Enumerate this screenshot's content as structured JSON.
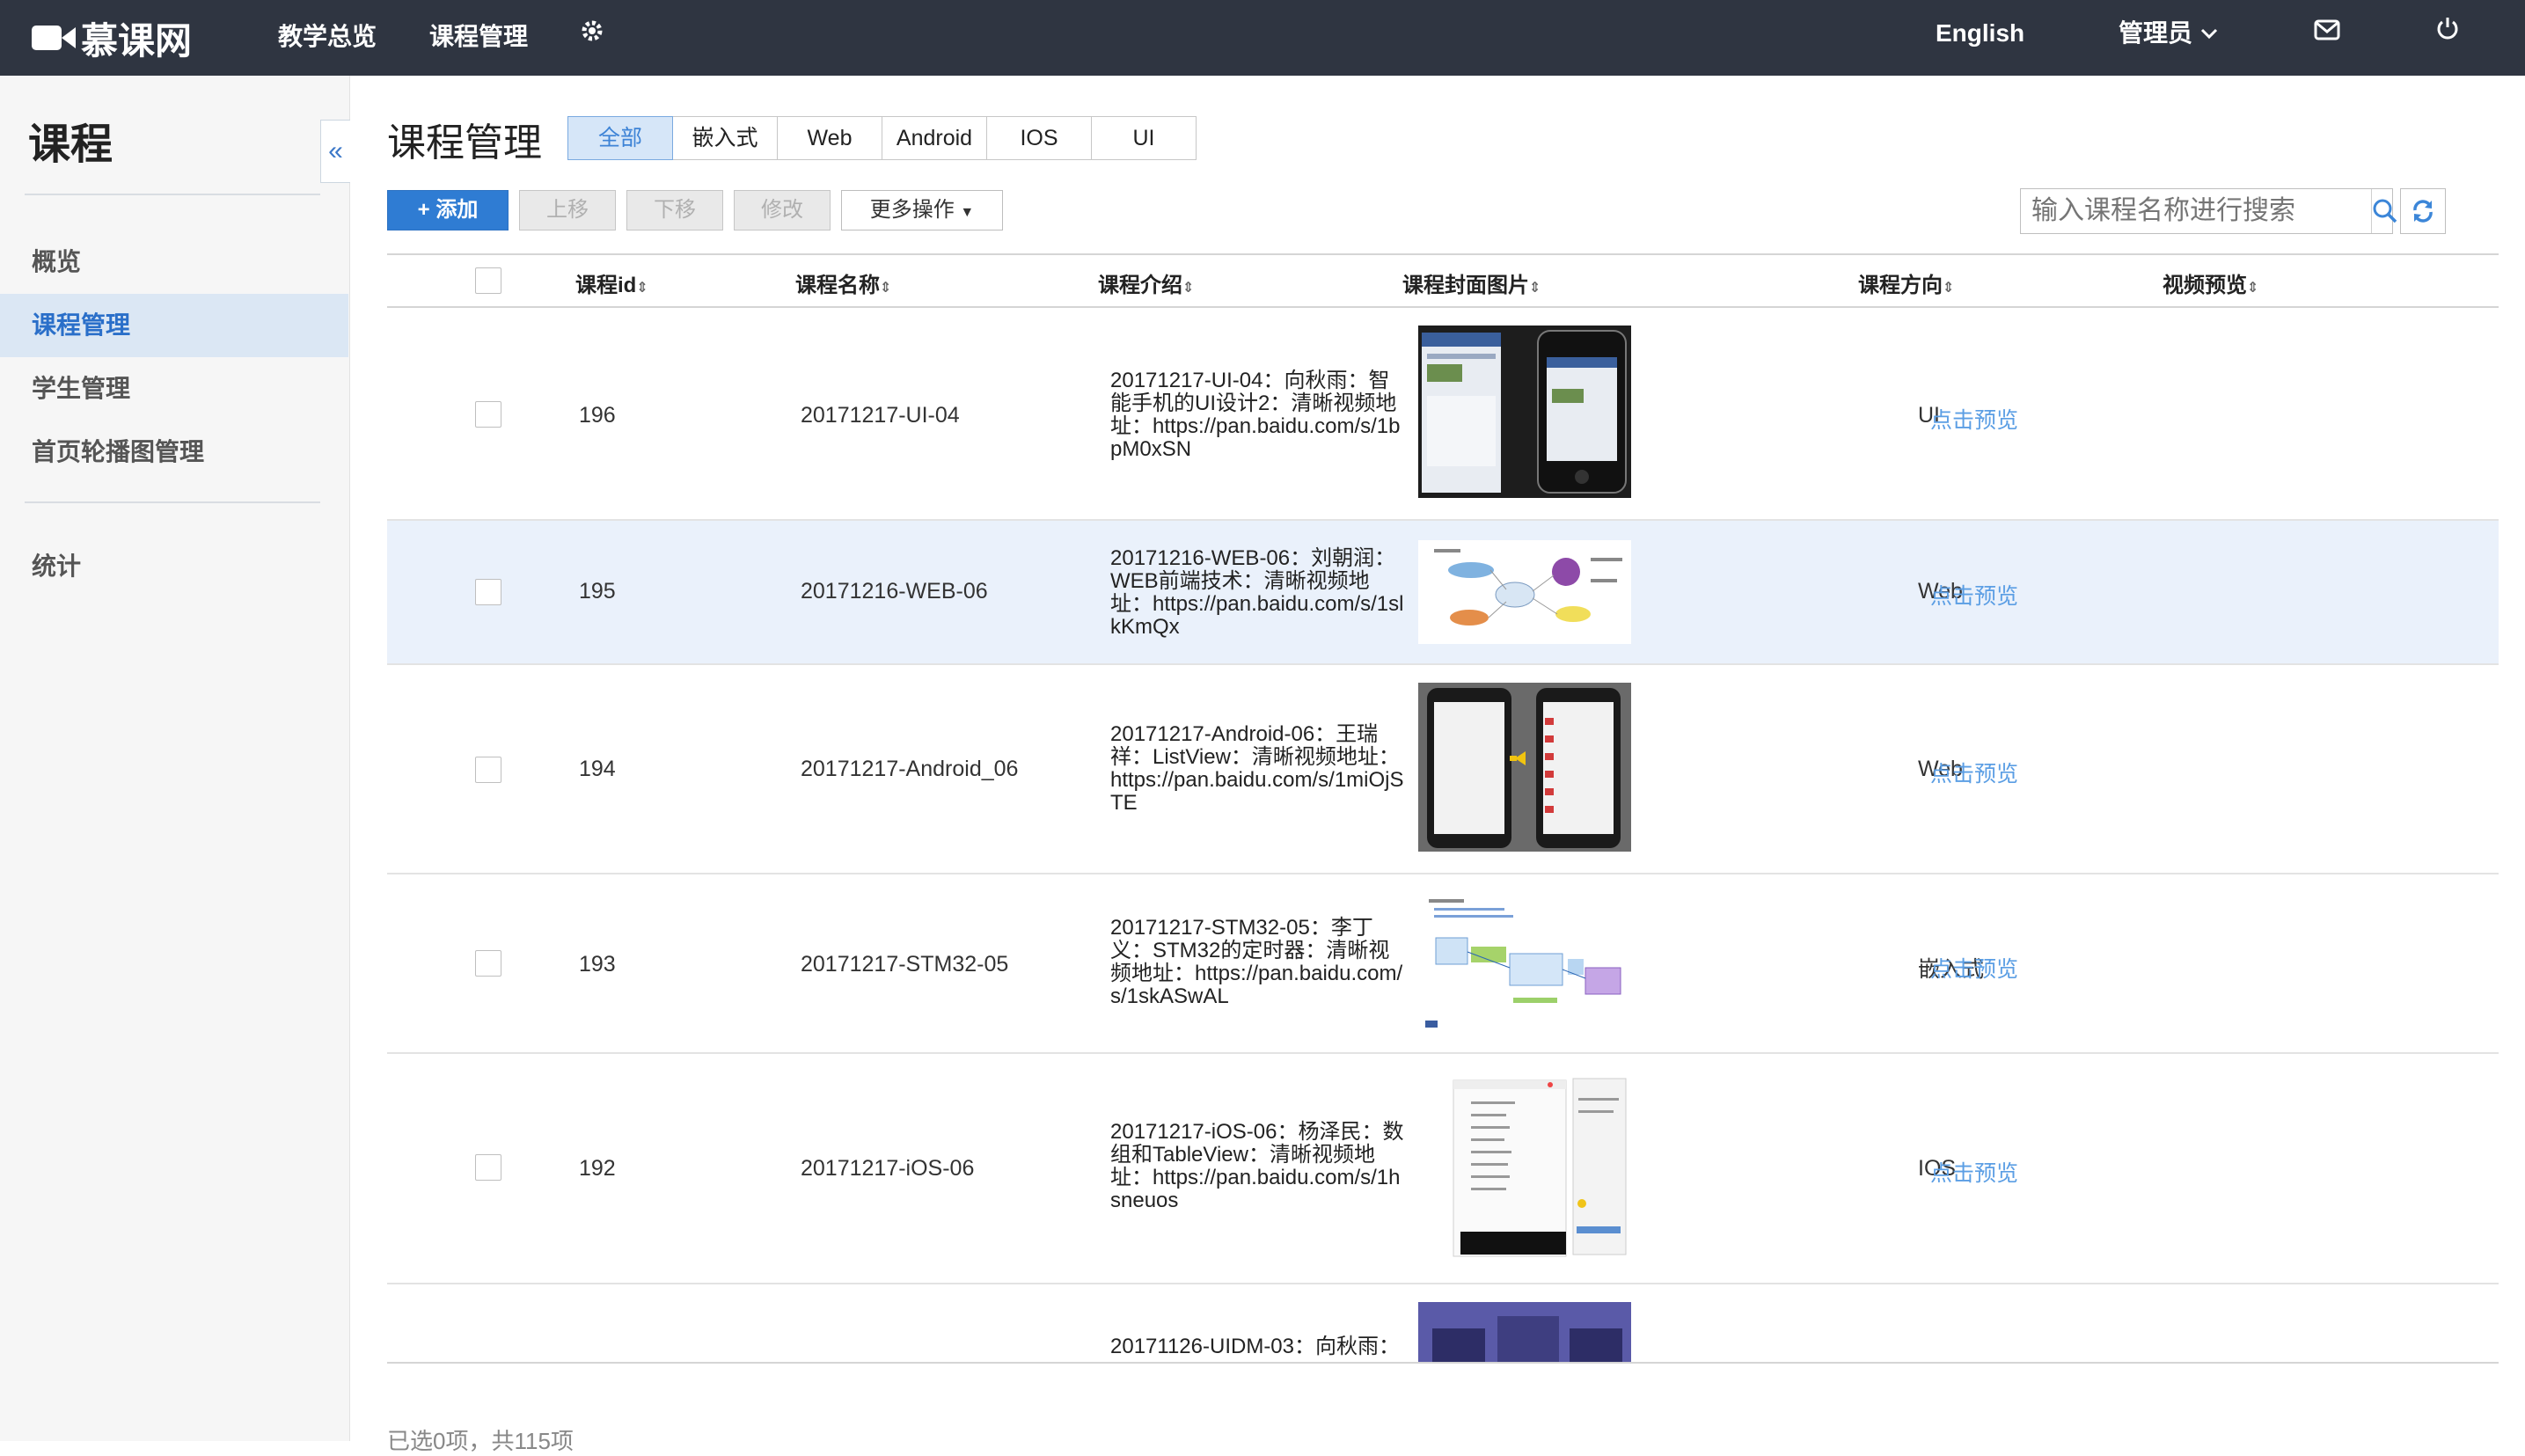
{
  "header": {
    "brand": "慕课网",
    "nav": [
      "教学总览",
      "课程管理"
    ],
    "settings_icon": "gear-icon",
    "language": "English",
    "user": "管理员",
    "mail_icon": "mail-icon",
    "logout_icon": "power-icon"
  },
  "sidebar": {
    "title": "课程",
    "items": [
      {
        "label": "概览"
      },
      {
        "label": "课程管理"
      },
      {
        "label": "学生管理"
      },
      {
        "label": "首页轮播图管理"
      },
      {
        "label": "统计"
      }
    ]
  },
  "main": {
    "title": "课程管理",
    "tabs": [
      "全部",
      "嵌入式",
      "Web",
      "Android",
      "IOS",
      "UI"
    ],
    "toolbar": {
      "add": "添加",
      "up": "上移",
      "down": "下移",
      "edit": "修改",
      "more": "更多操作"
    },
    "search_placeholder": "输入课程名称进行搜索",
    "columns": [
      "课程id",
      "课程名称",
      "课程介绍",
      "课程封面图片",
      "课程方向",
      "视频预览"
    ],
    "rows": [
      {
        "id": "196",
        "name": "20171217-UI-04",
        "desc": "20171217-UI-04：向秋雨：智能手机的UI设计2：清晰视频地址：https://pan.baidu.com/s/1bpM0xSN",
        "direction": "UI",
        "preview": "点击预览"
      },
      {
        "id": "195",
        "name": "20171216-WEB-06",
        "desc": "20171216-WEB-06：刘朝润：WEB前端技术：清晰视频地址：https://pan.baidu.com/s/1slkKmQx",
        "direction": "Web",
        "preview": "点击预览"
      },
      {
        "id": "194",
        "name": "20171217-Android_06",
        "desc": "20171217-Android-06：王瑞祥：ListView：清晰视频地址：https://pan.baidu.com/s/1miOjSTE",
        "direction": "Web",
        "preview": "点击预览"
      },
      {
        "id": "193",
        "name": "20171217-STM32-05",
        "desc": "20171217-STM32-05：李丁义：STM32的定时器：清晰视频地址：https://pan.baidu.com/s/1skASwAL",
        "direction": "嵌入式",
        "preview": "点击预览"
      },
      {
        "id": "192",
        "name": "20171217-iOS-06",
        "desc": "20171217-iOS-06：杨泽民：数组和TableView：清晰视频地址：https://pan.baidu.com/s/1hsneuos",
        "direction": "IOS",
        "preview": "点击预览"
      },
      {
        "id": "",
        "name": "",
        "desc": "20171126-UIDM-03：向秋雨：",
        "direction": "",
        "preview": ""
      }
    ]
  },
  "footer": {
    "summary": "已选0项，共115项"
  },
  "colors": {
    "topbar": "#2f3541",
    "accent": "#2f7cd3",
    "link": "#5b9ee4",
    "highlight_row": "#eaf1fb"
  }
}
